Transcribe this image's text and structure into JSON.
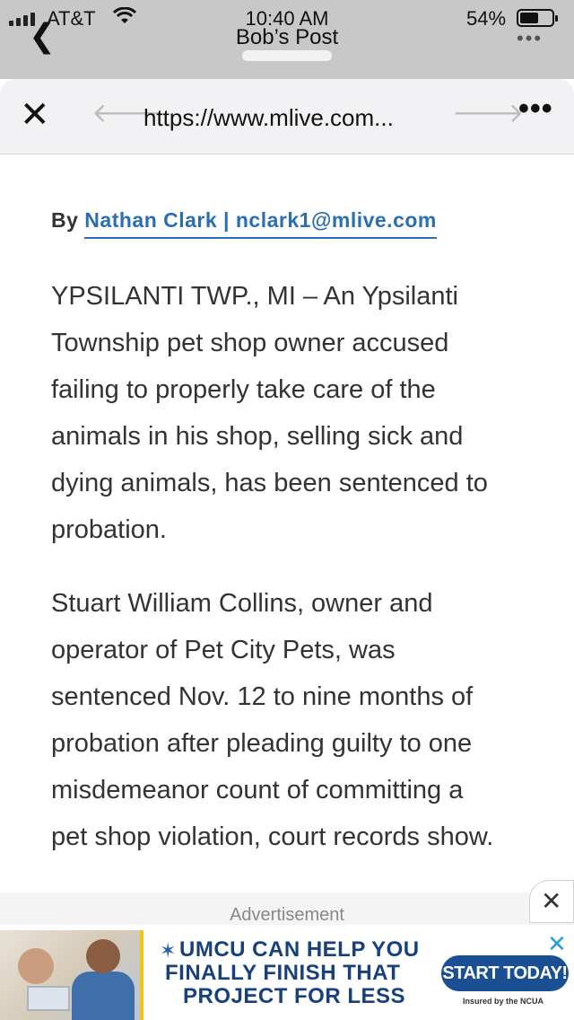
{
  "status_bar": {
    "carrier": "AT&T",
    "time": "10:40 AM",
    "sheet_title": "Bob’s Post",
    "battery_percent": "54%",
    "battery_level": 0.54
  },
  "browser": {
    "url": "https://www.mlive.com..."
  },
  "article": {
    "byline_prefix": "By",
    "byline_author": "Nathan Clark | nclark1@mlive.com",
    "paragraph1_lines": [
      "YPSILANTI TWP., MI – An Ypsilanti",
      "Township pet shop owner accused",
      "failing to properly take care of the",
      "animals in his shop, selling sick and",
      "dying animals, has been sentenced to",
      "probation."
    ],
    "paragraph2_lines": [
      "Stuart William Collins, owner and",
      "operator of Pet City Pets, was",
      "sentenced Nov. 12 to nine months of",
      "probation after pleading guilty to one",
      "misdemeanor count of committing a",
      "pet shop violation, court records show."
    ]
  },
  "ad": {
    "label": "Advertisement",
    "line1": "UMCU CAN HELP YOU",
    "line2": "FINALLY FINISH THAT",
    "line3": "PROJECT FOR LESS",
    "cta": "START TODAY!",
    "fine_print": "Insured by the NCUA"
  },
  "icons": {
    "back": "chevron-left-icon",
    "wifi": "wifi-icon",
    "battery": "battery-icon",
    "close": "close-icon",
    "nav_back": "arrow-left-icon",
    "nav_forward": "arrow-right-icon",
    "more": "more-icon"
  }
}
